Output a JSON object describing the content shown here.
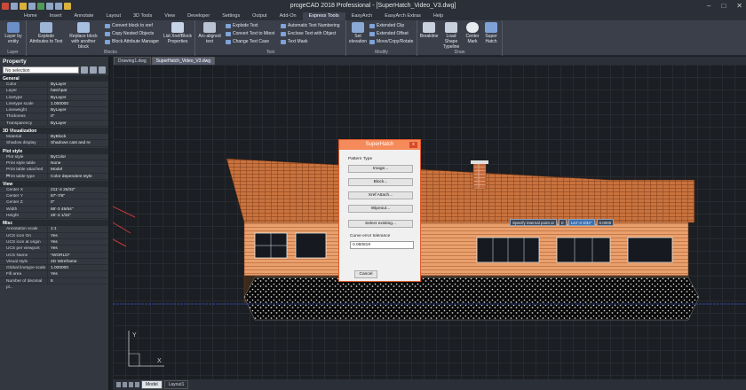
{
  "app": {
    "title": "progeCAD 2018 Professional - [SuperHatch_Video_V3.dwg]"
  },
  "menu_tabs": [
    "Home",
    "Insert",
    "Annotate",
    "Layout",
    "3D Tools",
    "View",
    "Developer",
    "Settings",
    "Output",
    "Add-On",
    "Express Tools",
    "EasyArch",
    "EasyArch Extras",
    "Help"
  ],
  "ribbon": {
    "layer_btn": "Layer by entity",
    "layer_group": "Layer",
    "explode_btn": "Explode Attributes to Text",
    "replace_btn": "Replace block with another block",
    "convert_xref": "Convert block to xref",
    "copy_nested": "Copy Nested Objects",
    "block_attr": "Block Attribute Manager",
    "list_xref": "List Xref/Block Properties",
    "blocks_group": "Blocks",
    "arc_text": "Arc-aligned text",
    "explode_text": "Explode Text",
    "convert_mtext": "Convert Text to Mtext",
    "change_case": "Change Text Case",
    "auto_number": "Automatic Text Numbering",
    "enclose_text": "Enclose Text with Object",
    "text_mask": "Text Mask",
    "text_group": "Text",
    "set_elevation": "Set elevation",
    "extended_clip": "Extended Clip",
    "extended_offset": "Extended Offset",
    "move_copy": "Move/Copy/Rotate",
    "modify_group": "Modify",
    "breakline": "Breakline",
    "load_shape": "Load Shape Typeline",
    "center_mark": "Center Mark",
    "superhatch": "Super Hatch",
    "draw_group": "Draw"
  },
  "doc_tabs": [
    "Drawing1.dwg",
    "SuperHatch_Video_V3.dwg"
  ],
  "property": {
    "title": "Property",
    "selection": "No selection",
    "sections": [
      {
        "name": "General",
        "rows": [
          [
            "Color",
            "ByLayer"
          ],
          [
            "Layer",
            "hatchpat"
          ],
          [
            "Linetype",
            "ByLayer"
          ],
          [
            "Linetype scale",
            "1.000000"
          ],
          [
            "Lineweight",
            "ByLayer"
          ],
          [
            "Thickness",
            "0\""
          ],
          [
            "Transparency",
            "ByLayer"
          ]
        ]
      },
      {
        "name": "3D Visualization",
        "rows": [
          [
            "Material",
            "ByBlock"
          ],
          [
            "Shadow display",
            "Shadows cast and re"
          ]
        ]
      },
      {
        "name": "Plot style",
        "rows": [
          [
            "Plot style",
            "ByColor"
          ],
          [
            "Print style table",
            "None"
          ],
          [
            "Print table attached to",
            "Model"
          ],
          [
            "Print table type",
            "Color dependent style"
          ]
        ]
      },
      {
        "name": "View",
        "rows": [
          [
            "Center X",
            "211'-4 25/32\""
          ],
          [
            "Center Y",
            "87'-7/8\""
          ],
          [
            "Center Z",
            "0\""
          ],
          [
            "Width",
            "86'-3 45/64\""
          ],
          [
            "Height",
            "45'-3 1/32\""
          ]
        ]
      },
      {
        "name": "Misc",
        "rows": [
          [
            "Annotation scale",
            "1:1"
          ],
          [
            "UCS icon On",
            "Yes"
          ],
          [
            "UCS icon at origin",
            "Yes"
          ],
          [
            "UCS per viewport",
            "Yes"
          ],
          [
            "UCS Name",
            "*WORLD*"
          ],
          [
            "Visual style",
            "2D Wireframe"
          ],
          [
            "Global linetype scale",
            "1.000000"
          ],
          [
            "Fill area",
            "Yes"
          ],
          [
            "Number of decimal pl...",
            "6"
          ]
        ]
      }
    ]
  },
  "dialog": {
    "title": "SuperHatch",
    "close": "x",
    "pattern_type": "Pattern Type",
    "buttons": [
      "Image...",
      "Block...",
      "Xref Attach...",
      "Wipeout...",
      "Select existing..."
    ],
    "tolerance_label": "Curve error tolerance",
    "tolerance_value": "0.060819",
    "cancel": "Cancel"
  },
  "prompt": {
    "text": "Specify internal point or",
    "field1": "0",
    "field2": "142'-3 3/32\"",
    "field3": "0.0000"
  },
  "layout_tabs": [
    "Model",
    "Layout1"
  ]
}
